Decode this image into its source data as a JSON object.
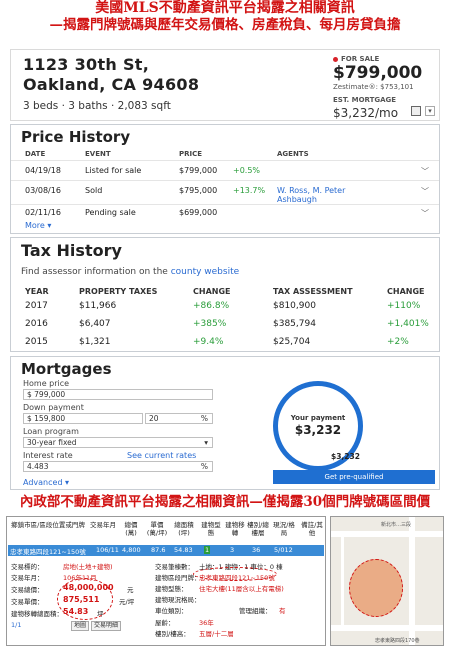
{
  "headline": {
    "line1": "美國MLS不動產資訊平台揭露之相關資訊",
    "line2": "—揭露門牌號碼與歷年交易價格、房產稅負、每月房貸負擔",
    "line3": "內政部不動產資訊平台揭露之相關資訊—僅揭露30個門牌號碼區間價"
  },
  "listing": {
    "address_line1": "1123 30th St,",
    "address_line2": "Oakland, CA 94608",
    "facts": "3 beds · 3 baths · 2,083 sqft",
    "for_sale_label": "FOR SALE",
    "price": "$799,000",
    "zestimate": "Zestimate®: $753,101",
    "est_mortgage_label": "EST. MORTGAGE",
    "est_mortgage_value": "$3,232/mo",
    "accent_color": "#d8232a"
  },
  "price_history": {
    "title": "Price History",
    "columns": [
      "DATE",
      "EVENT",
      "PRICE",
      "AGENTS"
    ],
    "rows": [
      {
        "date": "04/19/18",
        "event": "Listed for sale",
        "price": "$799,000",
        "change": "+0.5%",
        "agent": ""
      },
      {
        "date": "03/08/16",
        "event": "Sold",
        "price": "$795,000",
        "change": "+13.7%",
        "agent": "W. Ross, M. Peter Ashbaugh"
      },
      {
        "date": "02/11/16",
        "event": "Pending sale",
        "price": "$699,000",
        "change": "",
        "agent": ""
      }
    ],
    "more": "More"
  },
  "tax_history": {
    "title": "Tax History",
    "assessor_text": "Find assessor information on the",
    "assessor_link": "county website",
    "columns": [
      "YEAR",
      "PROPERTY TAXES",
      "CHANGE",
      "TAX ASSESSMENT",
      "CHANGE"
    ],
    "rows": [
      {
        "year": "2017",
        "taxes": "$11,966",
        "change": "+86.8%",
        "assessment": "$810,900",
        "change2": "+110%"
      },
      {
        "year": "2016",
        "taxes": "$6,407",
        "change": "+385%",
        "assessment": "$385,794",
        "change2": "+1,401%"
      },
      {
        "year": "2015",
        "taxes": "$1,321",
        "change": "+9.4%",
        "assessment": "$25,704",
        "change2": "+2%"
      }
    ]
  },
  "mortgages": {
    "title": "Mortgages",
    "home_price_label": "Home price",
    "home_price_value": "$ 799,000",
    "down_payment_label": "Down payment",
    "down_payment_value": "$ 159,800",
    "down_payment_pct": "20",
    "pct_sign": "%",
    "loan_program_label": "Loan program",
    "loan_program_value": "30-year fixed",
    "interest_rate_label": "Interest rate",
    "interest_rate_value": "4.483",
    "current_rates_link": "See current rates",
    "your_payment_label": "Your payment",
    "your_payment_value": "$3,232",
    "total": "$3,232",
    "cta": "Get pre-qualified",
    "advanced": "Advanced"
  },
  "tw_panel": {
    "headers": [
      "鄉鎮市區/區段位置或門牌",
      "交易年月",
      "總價(萬)",
      "單價(萬/坪)",
      "總面積(坪)",
      "建物型態",
      "建物移轉",
      "樓別/總樓層",
      "現況/格局",
      "備註/其他"
    ],
    "row": [
      "忠孝東路四段121~150號",
      "106/11",
      "4,800",
      "87.6",
      "54.83",
      "1",
      "3",
      "36",
      "5/012"
    ],
    "left_labels": [
      "交易標的：",
      "交易年月：",
      "交易總價：",
      "交易單價：",
      "建物移轉總面積：",
      "1/1"
    ],
    "left_values": [
      "房地(土地+建物)",
      "106年11月",
      "48,000,000",
      "875,511",
      "54.83",
      "元",
      "元/坪",
      "坪"
    ],
    "right_labels": [
      "交易筆棟數：",
      "建物區段門牌：",
      "建物型態：",
      "建物現況格局：",
      "車位類別：",
      "屋齡：",
      "樓別/樓高："
    ],
    "right_values": [
      "土地：1 建物：1 車位：0 棟",
      "忠孝東路四段121~150號",
      "住宅大樓(11層含以上有電梯)",
      "",
      "",
      "36年",
      "五層/十二層"
    ],
    "mgmt_label": "管理組織：",
    "mgmt_value": "有",
    "buttons": [
      "地圖",
      "交易明細"
    ],
    "map_top_label": "新北市…三段",
    "map_bottom_label": "忠孝東路四段170巷"
  }
}
